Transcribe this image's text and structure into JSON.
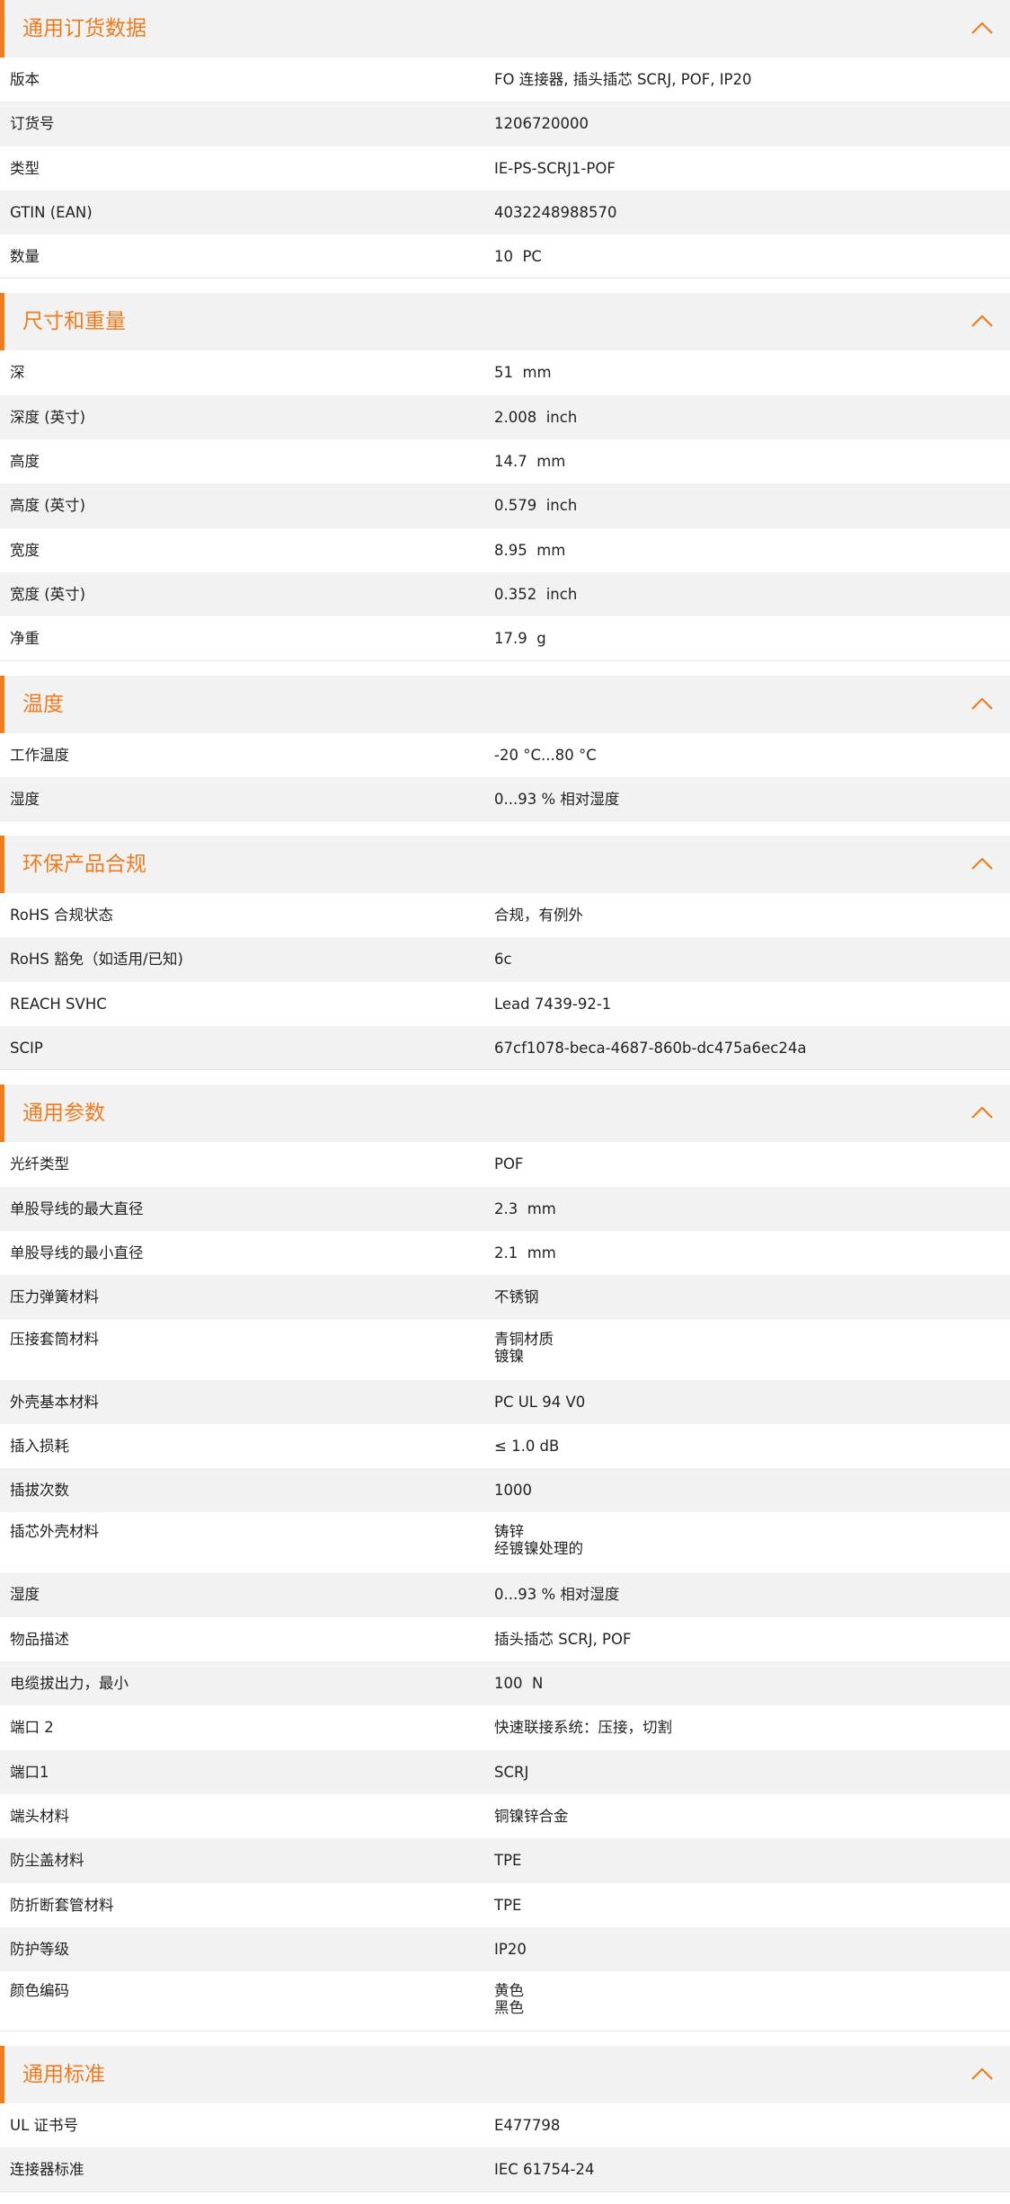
{
  "colors": {
    "accent": "#f07d1c",
    "header_bg": "#f2f2f2",
    "alt_row_bg": "#f2f2f2",
    "text": "#222222"
  },
  "sections": [
    {
      "id": "ordering",
      "title": "通用订货数据",
      "icon": "chevron-up-icon",
      "rows": [
        {
          "label": "版本",
          "value": "FO 连接器, 插头插芯 SCRJ, POF, IP20"
        },
        {
          "label": "订货号",
          "value": "1206720000"
        },
        {
          "label": "类型",
          "value": "IE-PS-SCRJ1-POF"
        },
        {
          "label": "GTIN (EAN)",
          "value": "4032248988570"
        },
        {
          "label": "数量",
          "value": "10  PC"
        }
      ]
    },
    {
      "id": "dimensions",
      "title": "尺寸和重量",
      "icon": "chevron-up-icon",
      "rows": [
        {
          "label": "深",
          "value": "51  mm"
        },
        {
          "label": "深度 (英寸)",
          "value": "2.008  inch"
        },
        {
          "label": "高度",
          "value": "14.7  mm"
        },
        {
          "label": "高度 (英寸)",
          "value": "0.579  inch"
        },
        {
          "label": "宽度",
          "value": "8.95  mm"
        },
        {
          "label": "宽度 (英寸)",
          "value": "0.352  inch"
        },
        {
          "label": "净重",
          "value": "17.9  g"
        }
      ]
    },
    {
      "id": "temperature",
      "title": "温度",
      "icon": "chevron-up-icon",
      "rows": [
        {
          "label": "工作温度",
          "value": "-20 °C...80 °C"
        },
        {
          "label": "湿度",
          "value": "0...93 % 相对湿度"
        }
      ]
    },
    {
      "id": "compliance",
      "title": "环保产品合规",
      "icon": "chevron-up-icon",
      "rows": [
        {
          "label": "RoHS 合规状态",
          "value": "合规，有例外"
        },
        {
          "label": "RoHS 豁免（如适用/已知)",
          "value": "6c"
        },
        {
          "label": "REACH SVHC",
          "value": "Lead 7439-92-1"
        },
        {
          "label": "SCIP",
          "value": "67cf1078-beca-4687-860b-dc475a6ec24a"
        }
      ]
    },
    {
      "id": "general",
      "title": "通用参数",
      "icon": "chevron-up-icon",
      "rows": [
        {
          "label": "光纤类型",
          "value": "POF"
        },
        {
          "label": "单股导线的最大直径",
          "value": "2.3  mm"
        },
        {
          "label": "单股导线的最小直径",
          "value": "2.1  mm"
        },
        {
          "label": "压力弹簧材料",
          "value": "不锈钢"
        },
        {
          "label": "压接套筒材料",
          "value": "青铜材质\n镀镍"
        },
        {
          "label": "外壳基本材料",
          "value": "PC UL 94 V0"
        },
        {
          "label": "插入损耗",
          "value": "≤ 1.0 dB"
        },
        {
          "label": "插拔次数",
          "value": "1000"
        },
        {
          "label": "插芯外壳材料",
          "value": "铸锌\n经镀镍处理的"
        },
        {
          "label": "湿度",
          "value": "0...93 % 相对湿度"
        },
        {
          "label": "物品描述",
          "value": "插头插芯 SCRJ, POF"
        },
        {
          "label": "电缆拔出力，最小",
          "value": "100  N"
        },
        {
          "label": "端口 2",
          "value": "快速联接系统：压接，切割"
        },
        {
          "label": "端口1",
          "value": "SCRJ"
        },
        {
          "label": "端头材料",
          "value": "铜镍锌合金"
        },
        {
          "label": "防尘盖材料",
          "value": "TPE"
        },
        {
          "label": "防折断套管材料",
          "value": "TPE"
        },
        {
          "label": "防护等级",
          "value": "IP20"
        },
        {
          "label": "颜色编码",
          "value": "黄色\n黑色"
        }
      ]
    },
    {
      "id": "standards",
      "title": "通用标准",
      "icon": "chevron-up-icon",
      "rows": [
        {
          "label": "UL 证书号",
          "value": "E477798"
        },
        {
          "label": "连接器标准",
          "value": "IEC 61754-24"
        }
      ]
    }
  ]
}
